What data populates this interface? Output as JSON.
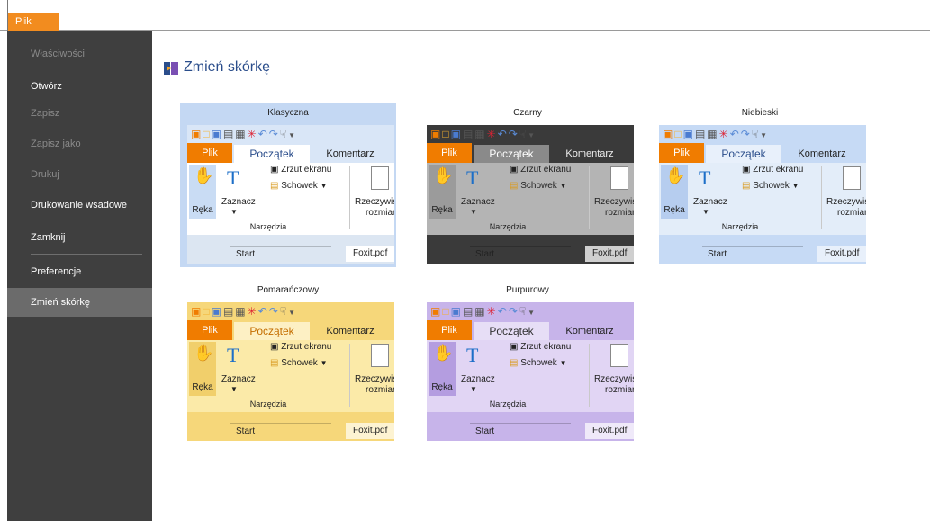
{
  "header": {
    "file_tab": "Plik"
  },
  "sidebar": {
    "items": [
      {
        "label": "Właściwości",
        "enabled": false
      },
      {
        "label": "Otwórz",
        "enabled": true
      },
      {
        "label": "Zapisz",
        "enabled": false
      },
      {
        "label": "Zapisz jako",
        "enabled": false
      },
      {
        "label": "Drukuj",
        "enabled": false
      },
      {
        "label": "Drukowanie wsadowe",
        "enabled": true
      },
      {
        "label": "Zamknij",
        "enabled": true
      },
      {
        "label": "Preferencje",
        "enabled": true
      },
      {
        "label": "Zmień skórkę",
        "enabled": true,
        "active": true
      }
    ]
  },
  "main": {
    "title": "Zmień skórkę",
    "preview_labels": {
      "plik": "Plik",
      "poczatek": "Początek",
      "komentarz": "Komentarz",
      "reka": "Ręka",
      "zaznacz": "Zaznacz",
      "zrzut": "Zrzut ekranu",
      "schowek": "Schowek",
      "rzeczywisty_1": "Rzeczywist",
      "rzeczywisty_2": "rozmiar",
      "narzedzia": "Narzędzia",
      "start": "Start",
      "foxit": "Foxit.pdf"
    },
    "skins": [
      {
        "name": "Klasyczna",
        "selected": true,
        "colors": {
          "qat": "#d9e6f7",
          "tabs": "#d9e6f7",
          "active_tab": "#ffffff",
          "ribbon": "#ffffff",
          "reka": "#c9dcf4",
          "text": "#222222",
          "tab_text": "#2a4d8b",
          "doc": "#dce6f2",
          "foxit": "#ffffff"
        }
      },
      {
        "name": "Czarny",
        "selected": false,
        "colors": {
          "qat": "#3a3a3a",
          "tabs": "#3a3a3a",
          "active_tab": "#8a8a8a",
          "ribbon": "#b4b4b4",
          "reka": "#9b9b9b",
          "text": "#222222",
          "tab_text": "#ffffff",
          "doc": "#3a3a3a",
          "foxit": "#cfcfcf"
        }
      },
      {
        "name": "Niebieski",
        "selected": false,
        "colors": {
          "qat": "#c6daf5",
          "tabs": "#c6daf5",
          "active_tab": "#e8f0fb",
          "ribbon": "#e3edf9",
          "reka": "#b6cdef",
          "text": "#222222",
          "tab_text": "#2a4d8b",
          "doc": "#c6daf5",
          "foxit": "#e8f0fb"
        }
      },
      {
        "name": "Pomarańczowy",
        "selected": false,
        "colors": {
          "qat": "#f6d77a",
          "tabs": "#f6d77a",
          "active_tab": "#fdf0c4",
          "ribbon": "#fbeaa8",
          "reka": "#f1cf6b",
          "text": "#222222",
          "tab_text": "#c46d00",
          "doc": "#f6d77a",
          "foxit": "#fdf3d2"
        }
      },
      {
        "name": "Purpurowy",
        "selected": false,
        "colors": {
          "qat": "#c7b4ea",
          "tabs": "#c7b4ea",
          "active_tab": "#e7def6",
          "ribbon": "#e1d5f4",
          "reka": "#b49de0",
          "text": "#222222",
          "tab_text": "#333333",
          "doc": "#c7b4ea",
          "foxit": "#efe9f9"
        }
      }
    ]
  }
}
